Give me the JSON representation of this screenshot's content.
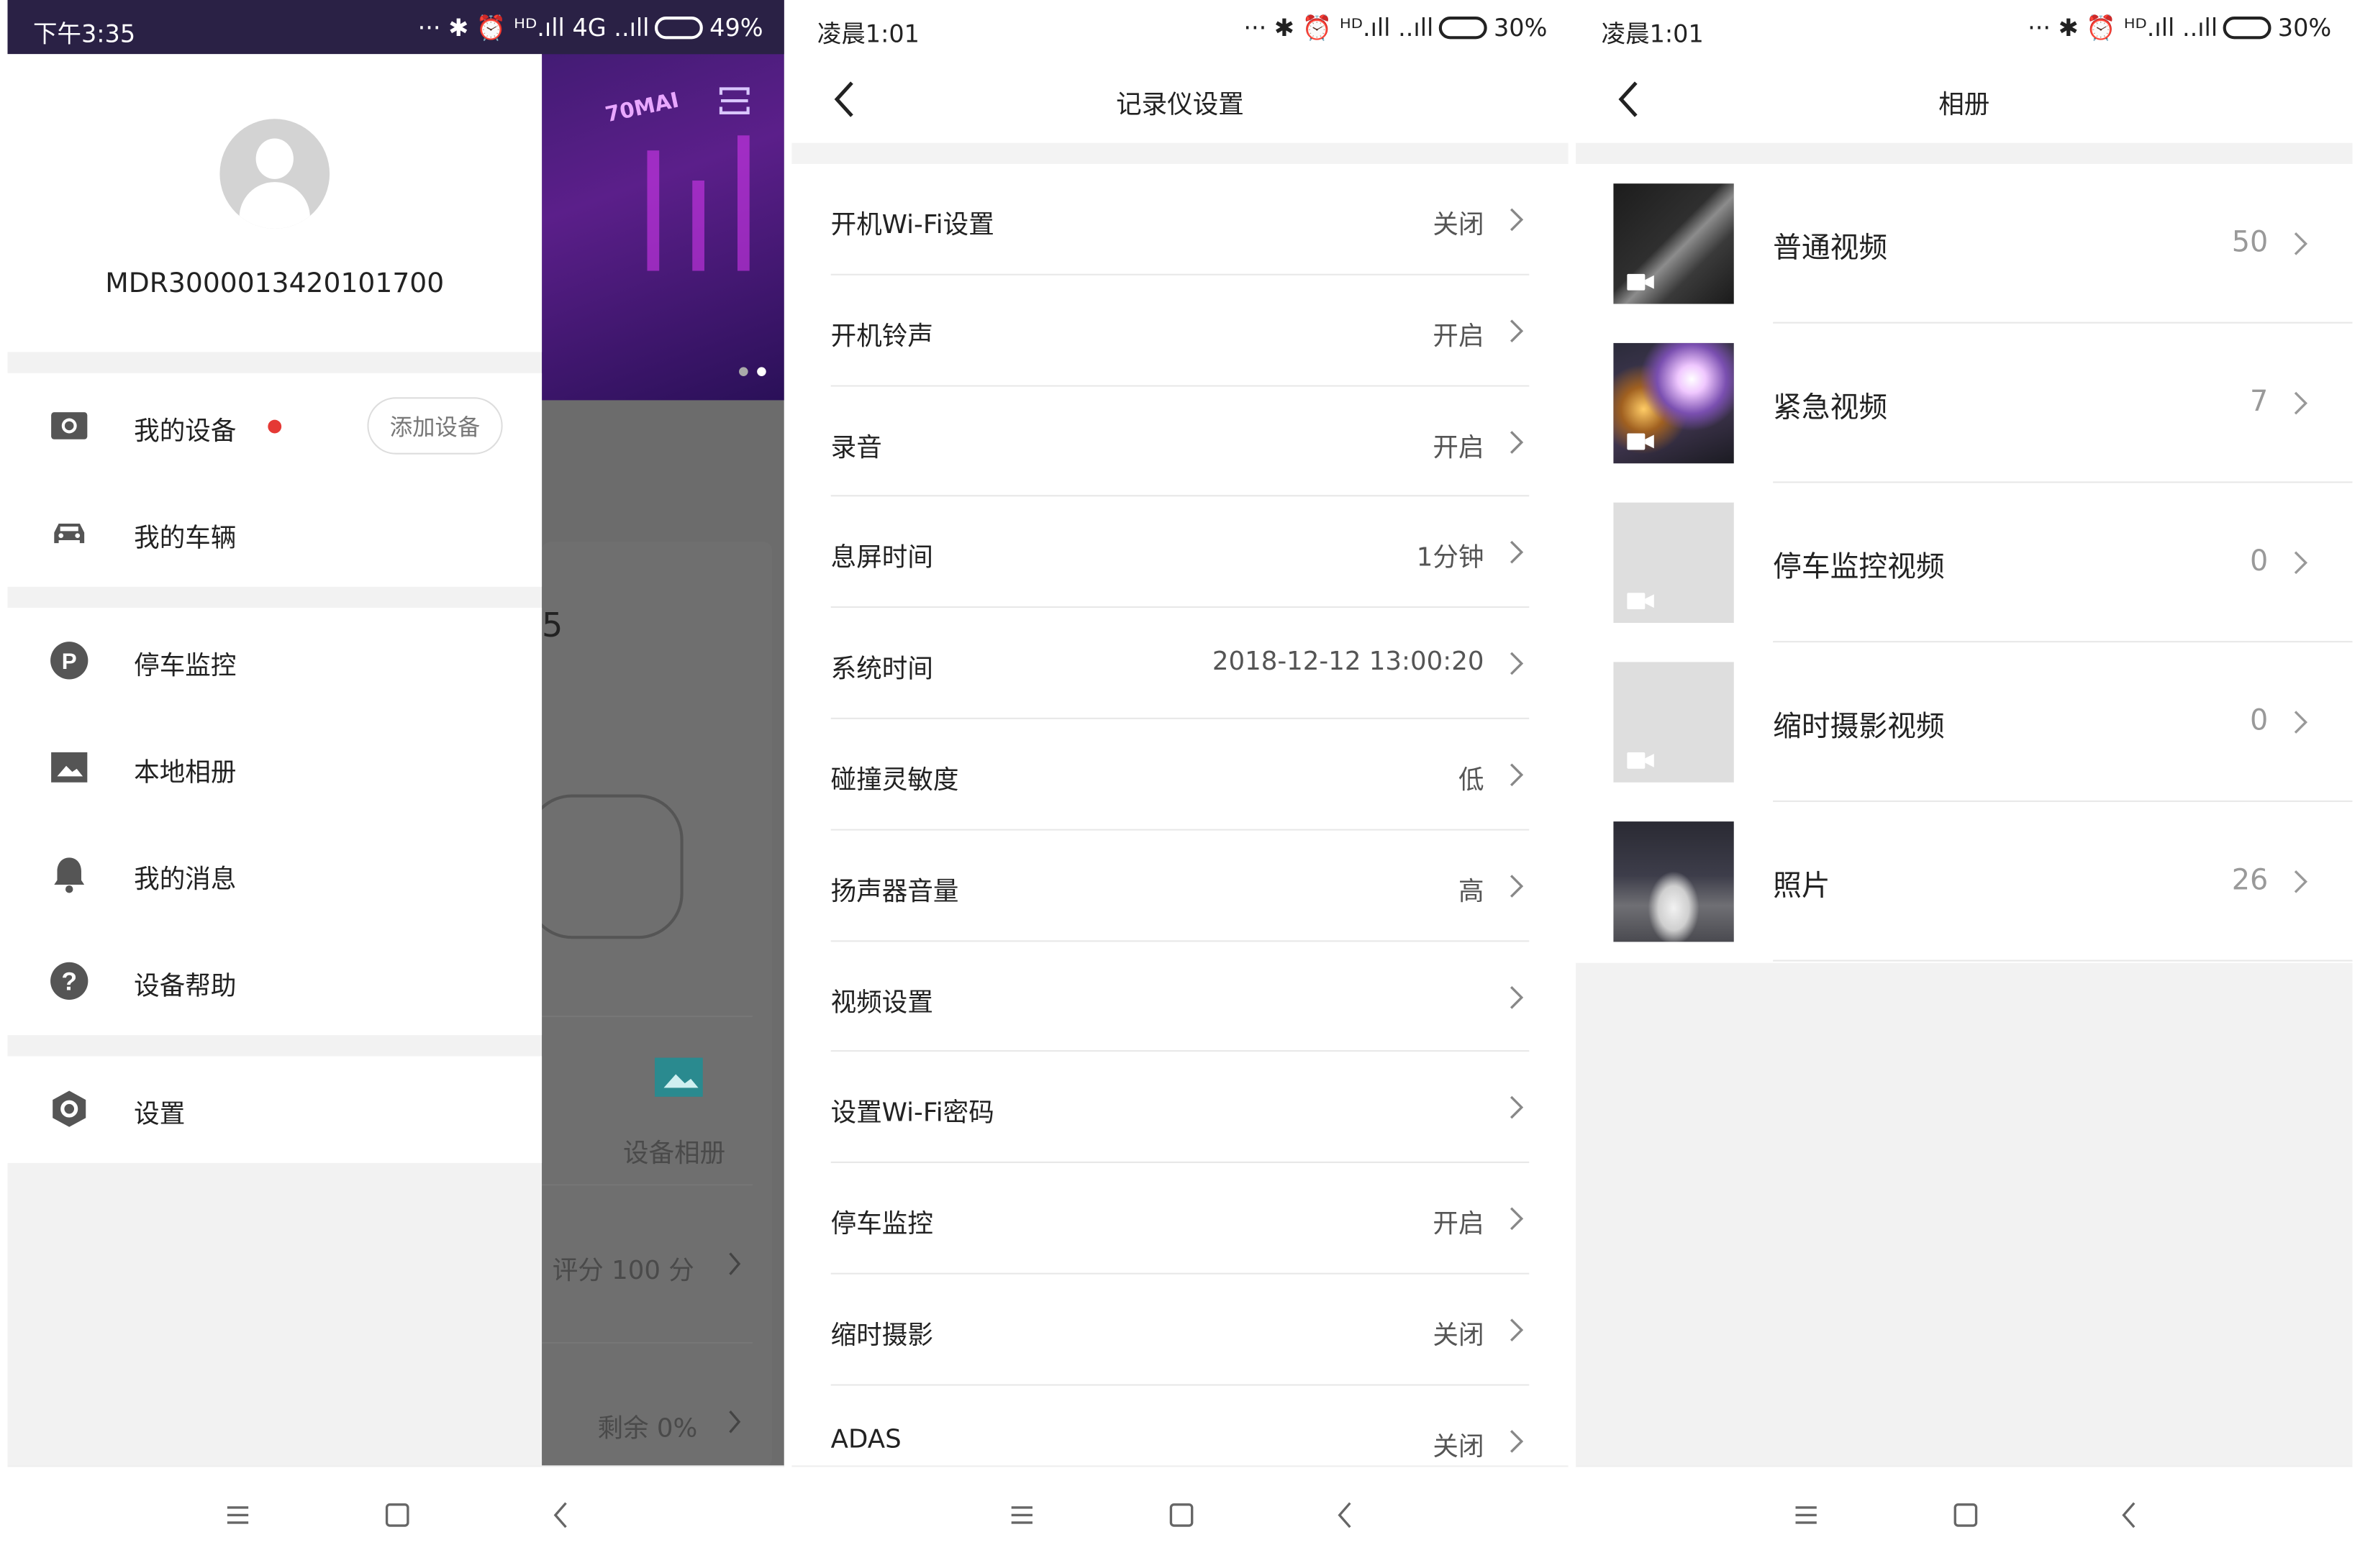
{
  "panel1": {
    "status": {
      "time": "下午3:35",
      "icons": "··· ✱ ⏰ ᴴᴰ.ıll 4G ..ıll",
      "battery": "49%"
    },
    "device_id": "MDR3000013420101700",
    "menu_group1": [
      {
        "label": "我的设备",
        "icon": "camera-icon",
        "add_button": "添加设备"
      },
      {
        "label": "我的车辆",
        "icon": "car-icon"
      }
    ],
    "menu_group2": [
      {
        "label": "停车监控",
        "icon": "parking-icon"
      },
      {
        "label": "本地相册",
        "icon": "picture-icon"
      },
      {
        "label": "我的消息",
        "icon": "bell-icon"
      },
      {
        "label": "设备帮助",
        "icon": "help-icon"
      }
    ],
    "menu_group3": [
      {
        "label": "设置",
        "icon": "settings-icon"
      }
    ],
    "background": {
      "hero_text": "70MAI",
      "digit": "5",
      "album_label": "设备相册",
      "score_label": "评分 100 分",
      "remaining_label": "剩余 0%"
    }
  },
  "panel2": {
    "status": {
      "time": "凌晨1:01",
      "icons": "··· ✱ ⏰ ᴴᴰ.ıll ..ıll",
      "battery": "30%"
    },
    "title": "记录仪设置",
    "rows": [
      {
        "label": "开机Wi-Fi设置",
        "value": "关闭"
      },
      {
        "label": "开机铃声",
        "value": "开启"
      },
      {
        "label": "录音",
        "value": "开启"
      },
      {
        "label": "息屏时间",
        "value": "1分钟"
      },
      {
        "label": "系统时间",
        "value": "2018-12-12 13:00:20"
      },
      {
        "label": "碰撞灵敏度",
        "value": "低"
      },
      {
        "label": "扬声器音量",
        "value": "高"
      },
      {
        "label": "视频设置",
        "value": ""
      },
      {
        "label": "设置Wi-Fi密码",
        "value": ""
      },
      {
        "label": "停车监控",
        "value": "开启"
      },
      {
        "label": "缩时摄影",
        "value": "关闭"
      },
      {
        "label": "ADAS",
        "value": "关闭"
      }
    ]
  },
  "panel3": {
    "status": {
      "time": "凌晨1:01",
      "icons": "··· ✱ ⏰ ᴴᴰ.ıll ..ıll",
      "battery": "30%"
    },
    "title": "相册",
    "rows": [
      {
        "label": "普通视频",
        "count": "50",
        "thumb": "dark-road-thumbnail"
      },
      {
        "label": "紧急视频",
        "count": "7",
        "thumb": "night-lights-thumbnail"
      },
      {
        "label": "停车监控视频",
        "count": "0",
        "thumb": "empty-thumbnail"
      },
      {
        "label": "缩时摄影视频",
        "count": "0",
        "thumb": "empty-thumbnail"
      },
      {
        "label": "照片",
        "count": "26",
        "thumb": "parked-car-thumbnail"
      }
    ]
  },
  "colors": {
    "accent_red": "#e53935",
    "icon_gray": "#555555",
    "separator": "#e8e8e8",
    "page_bg": "#f2f2f2",
    "hero_purple": "#5b1f8a"
  }
}
